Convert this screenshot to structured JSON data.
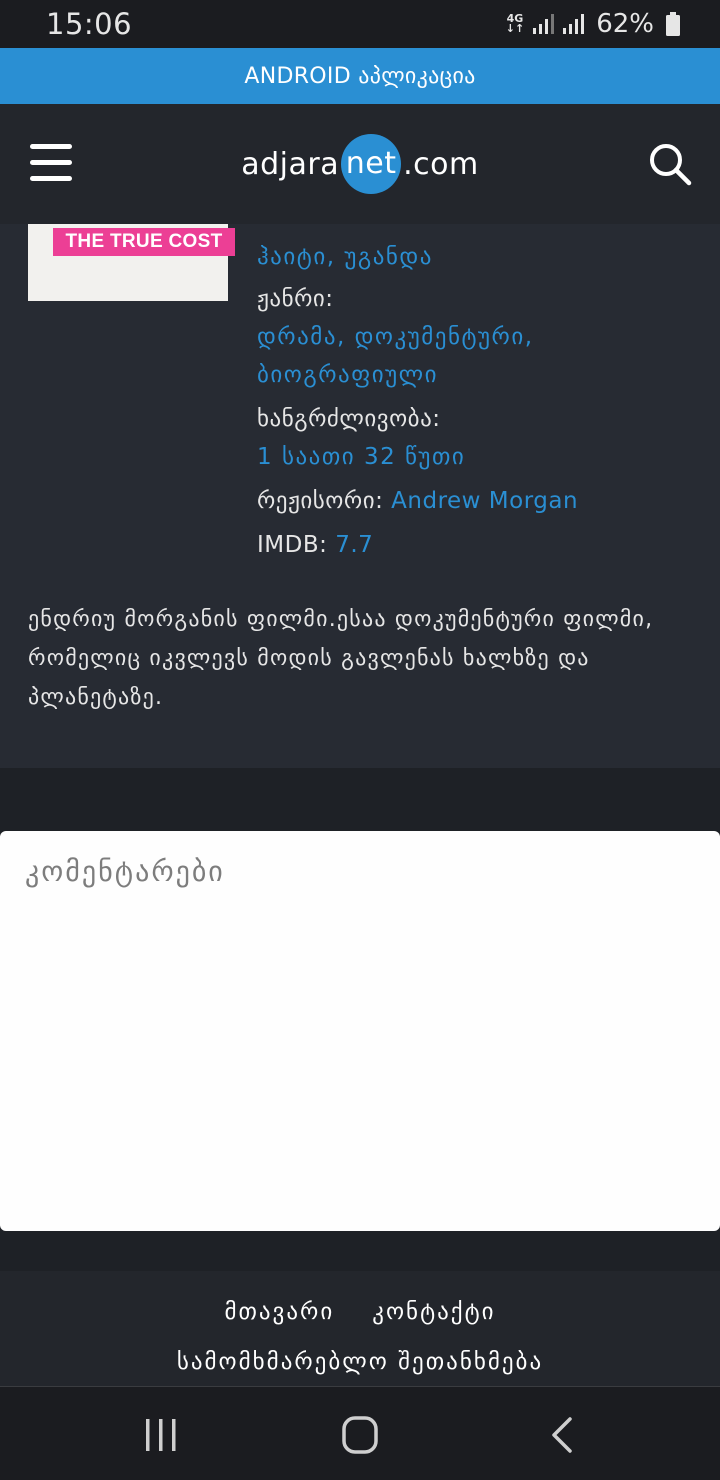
{
  "status_bar": {
    "time": "15:06",
    "network_type_top": "4G",
    "network_type_bottom": "↓↑",
    "battery_percent": "62%"
  },
  "app_banner": {
    "label": "ANDROID აპლიკაცია"
  },
  "header": {
    "logo_left": "adjara",
    "logo_badge": "net",
    "logo_right": ".com",
    "menu_icon": "hamburger-menu-icon",
    "search_icon": "search-icon"
  },
  "movie": {
    "poster_tag": "THE TRUE COST",
    "countries_line": "ჰაიტი, უგანდა",
    "genre_label": "ჟანრი:",
    "genre_line1": "დრამა, დოკუმენტური,",
    "genre_line2": "ბიოგრაფიული",
    "duration_label": "ხანგრძლივობა:",
    "duration_value": "1 საათი 32 წუთი",
    "director_label": "რეჟისორი:",
    "director_value": "Andrew Morgan",
    "imdb_label": "IMDB:",
    "imdb_value": "7.7",
    "description": "ენდრიუ მორგანის ფილმი.ესაა დოკუმენტური ფილმი, რომელიც იკვლევს მოდის გავლენას ხალხზე და პლანეტაზე."
  },
  "comments": {
    "title": "კომენტარები"
  },
  "footer": {
    "link_main": "მთავარი",
    "link_contact": "კონტაქტი",
    "terms": "სამომხმარებლო შეთანხმება"
  },
  "colors": {
    "accent": "#2a8fd3",
    "header_bg": "#23262c",
    "panel_bg": "#272b33",
    "poster_tag": "#ec3f95"
  }
}
